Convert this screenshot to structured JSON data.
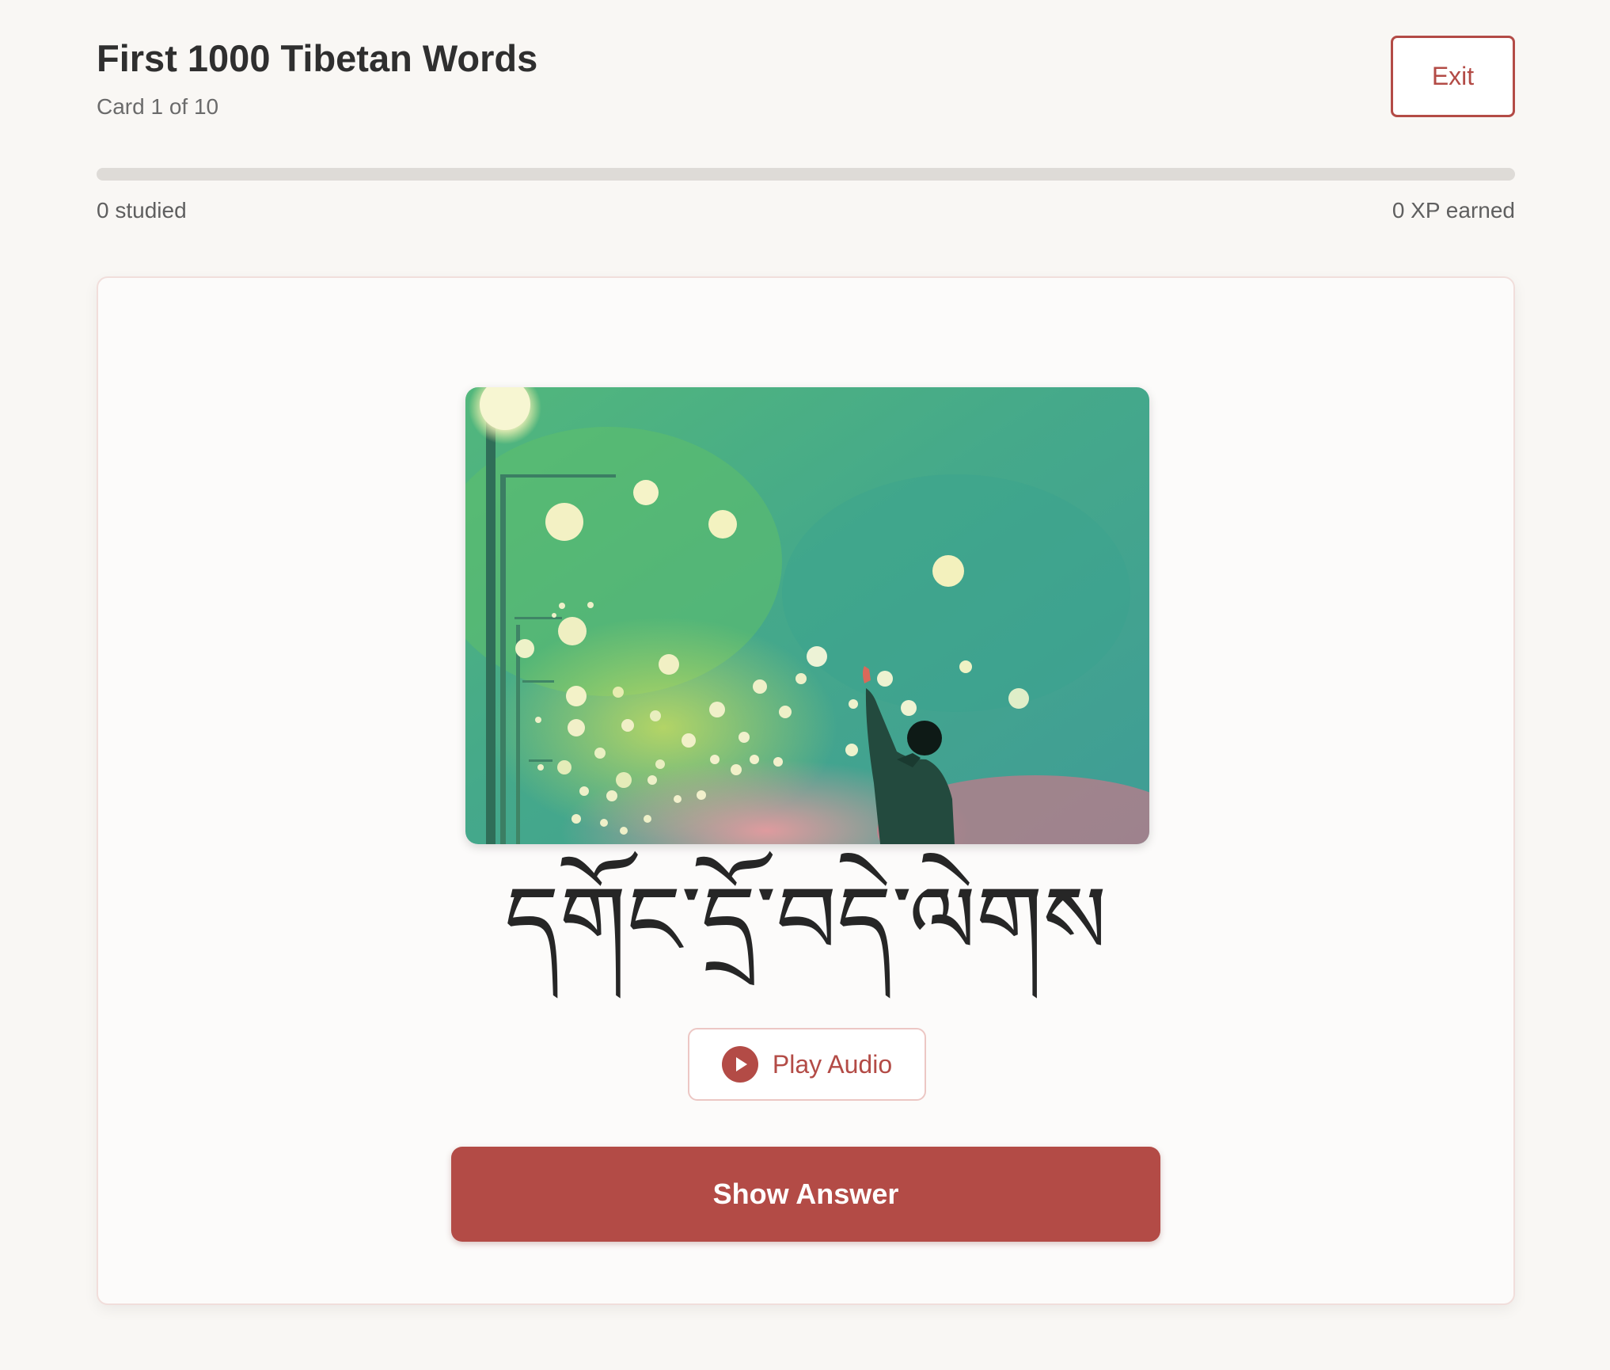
{
  "header": {
    "title": "First 1000 Tibetan Words",
    "subtitle": "Card 1 of 10",
    "exit_label": "Exit"
  },
  "progress": {
    "fraction": 0,
    "studied_label": "0 studied",
    "xp_label": "0 XP earned"
  },
  "card": {
    "illustration": "painted scene of a person waving toward floating lights beside streetlamps",
    "word": "དགོང་དྲོ་བདེ་ལེགས",
    "audio_label": "Play Audio",
    "audio_icon": "play-circle-icon",
    "answer_label": "Show Answer"
  },
  "colors": {
    "accent": "#b34b46",
    "background": "#f9f7f4",
    "card": "#fcfbfa",
    "track": "#dedbd7"
  }
}
